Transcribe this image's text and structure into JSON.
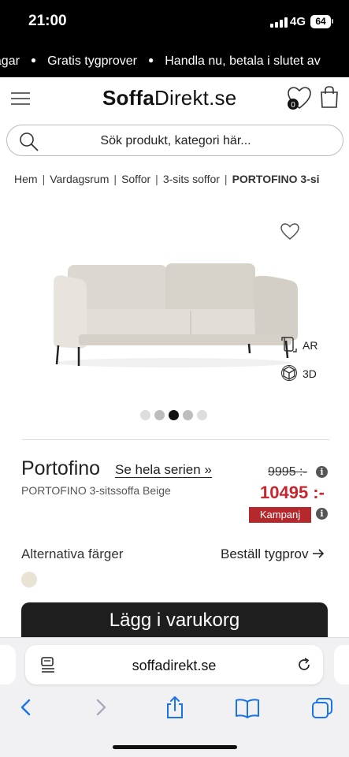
{
  "status_bar": {
    "time": "21:00",
    "network": "4G",
    "battery": "64"
  },
  "promo": {
    "items": [
      "dagar",
      "Gratis tygprover",
      "Handla nu, betala i slutet av"
    ]
  },
  "header": {
    "logo_bold": "Soffa",
    "logo_rest": "Direkt.se",
    "wishlist_count": "0"
  },
  "search": {
    "placeholder": "Sök produkt, kategori här..."
  },
  "breadcrumb": [
    "Hem",
    "Vardagsrum",
    "Soffor",
    "3-sits soffor",
    "PORTOFINO 3-si"
  ],
  "gallery": {
    "ar_label": "AR",
    "view3d_label": "3D",
    "active_dot": 3,
    "dot_count": 5
  },
  "product": {
    "name": "Portofino",
    "series_link": "Se hela serien »",
    "description": "PORTOFINO 3-sitssoffa Beige",
    "old_price": "9995 :-",
    "new_price": "10495 :-",
    "badge": "Kampanj"
  },
  "options": {
    "alt_colors_label": "Alternativa färger",
    "order_sample_label": "Beställ tygprov",
    "swatch_color": "#e9e3d6"
  },
  "cart_button": "Lägg i varukorg",
  "browser": {
    "url": "soffadirekt.se"
  },
  "colors": {
    "accent_red": "#c8262e",
    "badge_red": "#b5292d",
    "dark": "#1e1e1e"
  }
}
